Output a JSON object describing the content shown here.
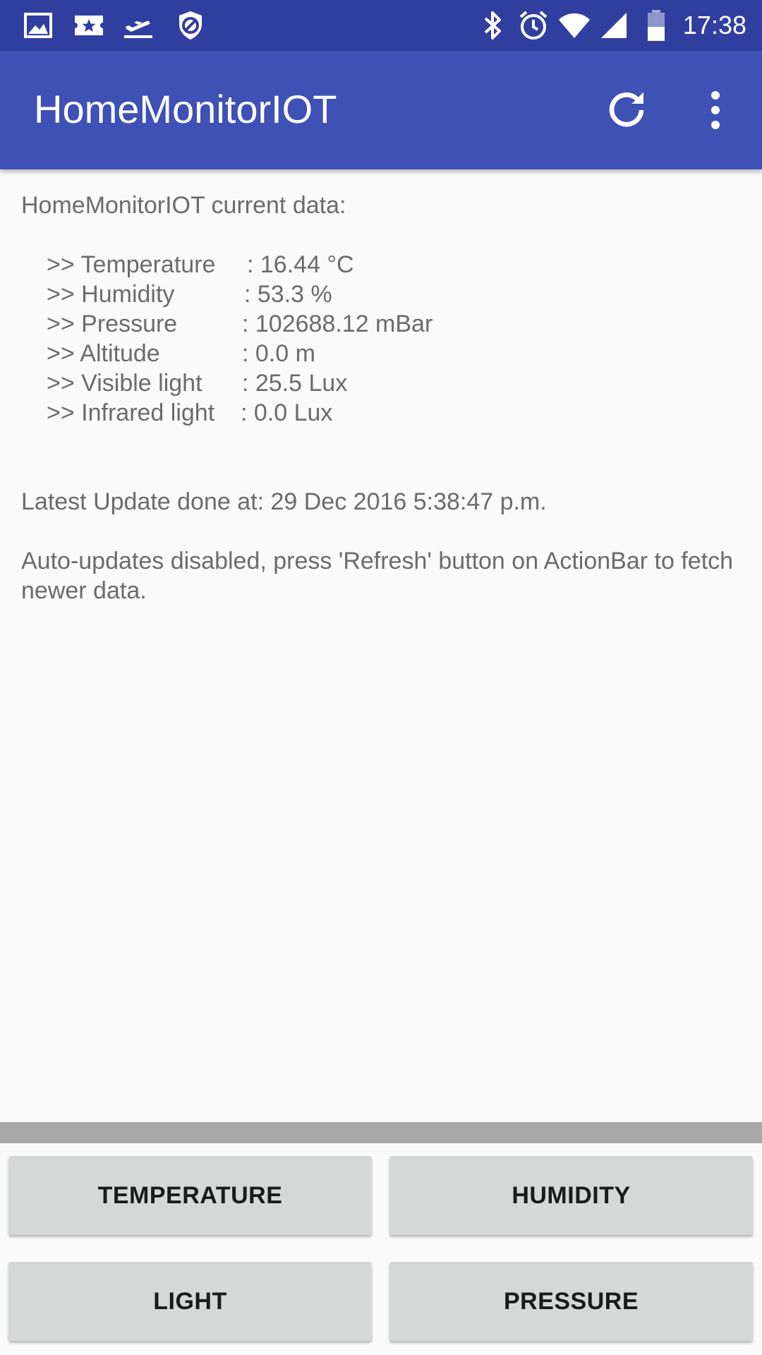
{
  "status_bar": {
    "time": "17:38",
    "left_icons": [
      "image-icon",
      "ticket-star-icon",
      "airplane-takeoff-icon",
      "shield-block-icon"
    ],
    "right_icons": [
      "bluetooth-icon",
      "alarm-icon",
      "wifi-icon",
      "cell-signal-icon",
      "battery-icon"
    ],
    "bar_color": "#303f9f"
  },
  "app_bar": {
    "title": "HomeMonitorIOT",
    "color": "#3f51b5",
    "actions": [
      "refresh-icon",
      "overflow-menu-icon"
    ]
  },
  "content": {
    "heading": "HomeMonitorIOT current data:",
    "readings": [
      {
        "label": ">> Temperature",
        "value": ": 16.44 °C"
      },
      {
        "label": ">> Humidity",
        "value": ": 53.3 %"
      },
      {
        "label": ">> Pressure",
        "value": ": 102688.12 mBar"
      },
      {
        "label": ">> Altitude",
        "value": ": 0.0 m"
      },
      {
        "label": ">> Visible light",
        "value": ": 25.5 Lux"
      },
      {
        "label": ">> Infrared light",
        "value": ": 0.0 Lux"
      }
    ],
    "latest_update": "Latest Update done at: 29 Dec 2016 5:38:47 p.m.",
    "auto_update_note": "Auto-updates disabled, press 'Refresh' button on ActionBar to fetch newer data."
  },
  "buttons": {
    "temperature": "TEMPERATURE",
    "humidity": "HUMIDITY",
    "light": "LIGHT",
    "pressure": "PRESSURE"
  }
}
